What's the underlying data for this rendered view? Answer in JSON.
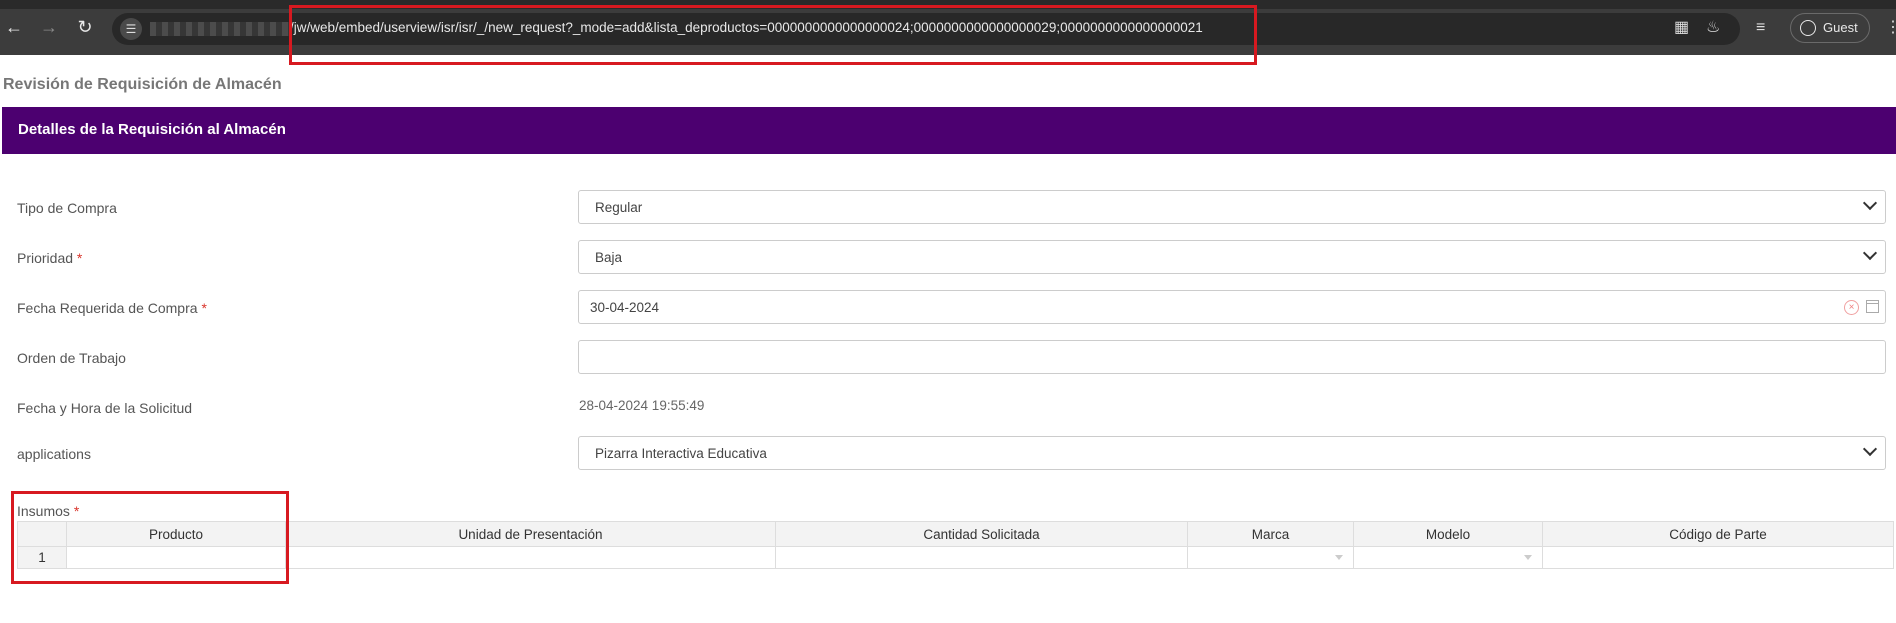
{
  "browser": {
    "url": "/jw/web/embed/userview/isr/isr/_/new_request?_mode=add&lista_deproductos=0000000000000000024;0000000000000000029;0000000000000000021",
    "profile_label": "Guest"
  },
  "page": {
    "title": "Revisión de Requisición de Almacén",
    "section_header": "Detalles de la Requisición al Almacén"
  },
  "form": {
    "tipo_compra": {
      "label": "Tipo de Compra",
      "value": "Regular"
    },
    "prioridad": {
      "label": "Prioridad",
      "required_mark": "*",
      "value": "Baja"
    },
    "fecha_requerida": {
      "label": "Fecha Requerida de Compra",
      "required_mark": "*",
      "value": "30-04-2024"
    },
    "orden_trabajo": {
      "label": "Orden de Trabajo",
      "value": ""
    },
    "fecha_hora_solicitud": {
      "label": "Fecha y Hora de la Solicitud",
      "value": "28-04-2024 19:55:49"
    },
    "applications": {
      "label": "applications",
      "value": "Pizarra Interactiva Educativa"
    },
    "insumos": {
      "label": "Insumos",
      "required_mark": "*"
    }
  },
  "grid": {
    "columns": [
      "Producto",
      "Unidad de Presentación",
      "Cantidad Solicitada",
      "Marca",
      "Modelo",
      "Código de Parte"
    ],
    "rows": [
      {
        "row_number": "1"
      }
    ]
  },
  "colors": {
    "header_bar": "#4c0070",
    "highlight": "#d71920"
  }
}
